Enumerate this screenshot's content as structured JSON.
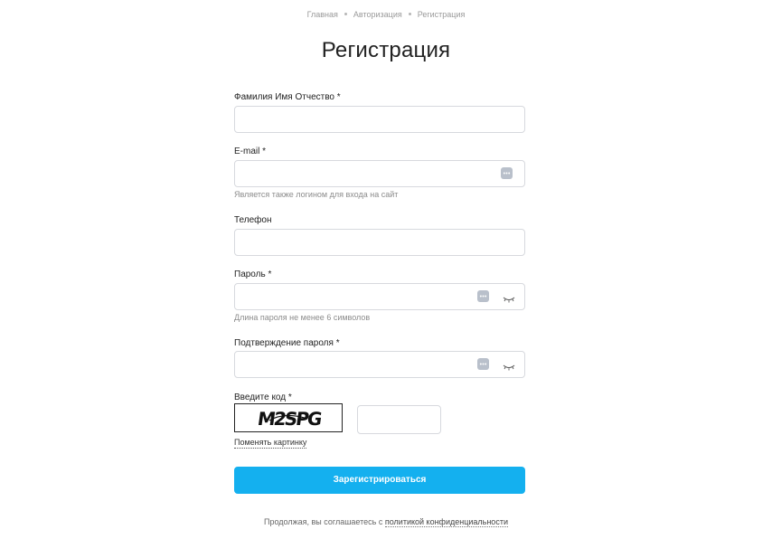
{
  "breadcrumb": {
    "items": [
      "Главная",
      "Авторизация",
      "Регистрация"
    ]
  },
  "page_title": "Регистрация",
  "form": {
    "full_name": {
      "label": "Фамилия Имя Отчество *",
      "value": ""
    },
    "email": {
      "label": "E-mail *",
      "value": "",
      "hint": "Является также логином для входа на сайт"
    },
    "phone": {
      "label": "Телефон",
      "value": ""
    },
    "password": {
      "label": "Пароль *",
      "value": "",
      "hint": "Длина пароля не менее 6 символов"
    },
    "password_confirm": {
      "label": "Подтверждение пароля *",
      "value": ""
    },
    "captcha": {
      "label": "Введите код *",
      "image_text": "M2SPG",
      "value": "",
      "change_link": "Поменять картинку"
    },
    "submit_label": "Зарегистрироваться"
  },
  "footer": {
    "note_prefix": "Продолжая, вы соглашаетесь с ",
    "policy_link": "политикой конфиденциальности"
  },
  "colors": {
    "accent": "#14b0ef",
    "input_border": "#d7d9de",
    "icon_gray": "#b9c0cb"
  },
  "icons": [
    "password-manager-dots-icon",
    "eye-closed-icon"
  ]
}
